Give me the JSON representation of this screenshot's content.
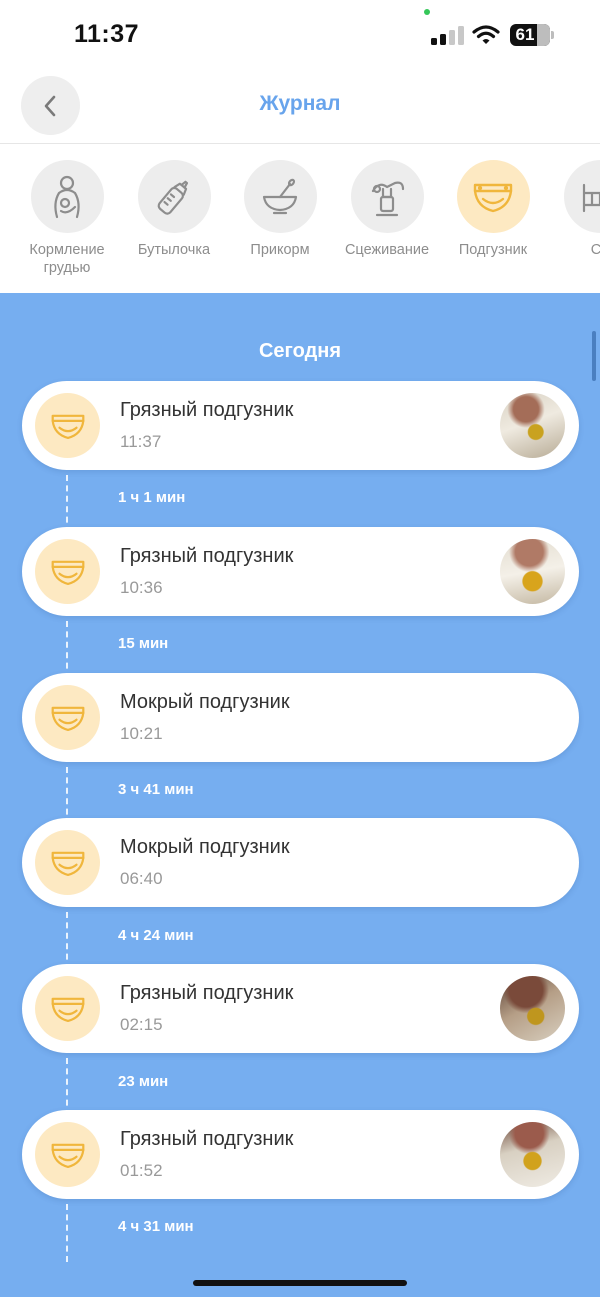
{
  "status_bar": {
    "time": "11:37",
    "battery": "61",
    "icons": [
      "signal-icon",
      "wifi-icon",
      "battery-icon"
    ]
  },
  "header": {
    "title": "Журнал",
    "back_icon": "chevron-left-icon"
  },
  "categories": [
    {
      "label": "Кормление грудью",
      "icon": "breastfeeding-icon",
      "active": false
    },
    {
      "label": "Бутылочка",
      "icon": "bottle-icon",
      "active": false
    },
    {
      "label": "Прикорм",
      "icon": "bowl-spoon-icon",
      "active": false
    },
    {
      "label": "Сцеживание",
      "icon": "breast-pump-icon",
      "active": false
    },
    {
      "label": "Подгузник",
      "icon": "diaper-icon",
      "active": true
    },
    {
      "label": "Со",
      "icon": "crib-icon",
      "active": false
    }
  ],
  "journal": {
    "section_title": "Сегодня",
    "entries": [
      {
        "title": "Грязный подгузник",
        "time": "11:37",
        "has_photo": true,
        "interval_after": "1 ч 1 мин"
      },
      {
        "title": "Грязный подгузник",
        "time": "10:36",
        "has_photo": true,
        "interval_after": "15 мин"
      },
      {
        "title": "Мокрый подгузник",
        "time": "10:21",
        "has_photo": false,
        "interval_after": "3 ч 41 мин"
      },
      {
        "title": "Мокрый подгузник",
        "time": "06:40",
        "has_photo": false,
        "interval_after": "4 ч 24 мин"
      },
      {
        "title": "Грязный подгузник",
        "time": "02:15",
        "has_photo": true,
        "interval_after": "23 мин"
      },
      {
        "title": "Грязный подгузник",
        "time": "01:52",
        "has_photo": true,
        "interval_after": "4 ч 31 мин"
      }
    ]
  },
  "colors": {
    "accent": "#68a4ec",
    "journal_background": "#76aef0",
    "diaper_icon": "#f0b63c",
    "diaper_icon_bg": "#fde9c2",
    "inactive_icon": "#8d8d8d"
  }
}
